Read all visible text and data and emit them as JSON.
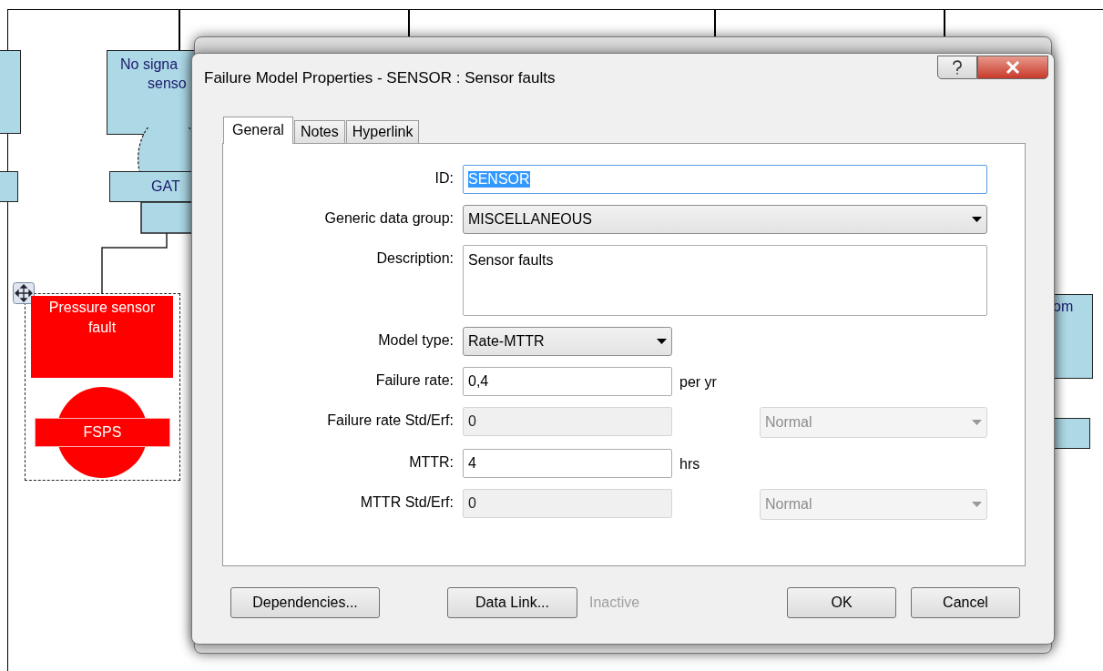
{
  "diagram": {
    "left_event": {
      "lines": [
        "No signa",
        "senso"
      ]
    },
    "gate": {
      "label": "GAT"
    },
    "selected_event": {
      "description": "Pressure sensor fault",
      "label": "FSPS",
      "selected": true
    },
    "right_event": {
      "lines": [
        "om"
      ]
    }
  },
  "back_dialog": {
    "kind": "dialog"
  },
  "dialog": {
    "title": "Failure Model Properties - SENSOR : Sensor faults",
    "tabs": [
      {
        "label": "General",
        "selected": true
      },
      {
        "label": "Notes",
        "selected": false
      },
      {
        "label": "Hyperlink",
        "selected": false
      }
    ],
    "fields": [
      {
        "label": "ID:",
        "kind": "text-wide",
        "value": "SENSOR",
        "highlighted": true,
        "disabled": false
      },
      {
        "label": "Generic data group:",
        "kind": "select-wide",
        "value": "MISCELLANEOUS",
        "disabled": false
      },
      {
        "label": "Description:",
        "kind": "textarea",
        "value": "Sensor faults",
        "disabled": false
      },
      {
        "label": "Model type:",
        "kind": "select",
        "value": "Rate-MTTR",
        "disabled": false
      },
      {
        "label": "Failure rate:",
        "kind": "text",
        "value": "0,4",
        "unit": "per yr",
        "disabled": false
      },
      {
        "label": "Failure rate Std/Erf:",
        "kind": "text",
        "value": "0",
        "disabled": true,
        "side_select": {
          "value": "Normal",
          "disabled": true
        }
      },
      {
        "label": "MTTR:",
        "kind": "text",
        "value": "4",
        "unit": "hrs",
        "disabled": false
      },
      {
        "label": "MTTR Std/Erf:",
        "kind": "text",
        "value": "0",
        "disabled": true,
        "side_select": {
          "value": "Normal",
          "disabled": true
        }
      }
    ],
    "buttons": [
      {
        "label": "Dependencies...",
        "kind": "left"
      },
      {
        "label": "Data Link...",
        "kind": "middle",
        "status": {
          "text": "Inactive",
          "disabled": true
        }
      },
      {
        "label": "OK",
        "kind": "right"
      },
      {
        "label": "Cancel",
        "kind": "right"
      }
    ]
  }
}
